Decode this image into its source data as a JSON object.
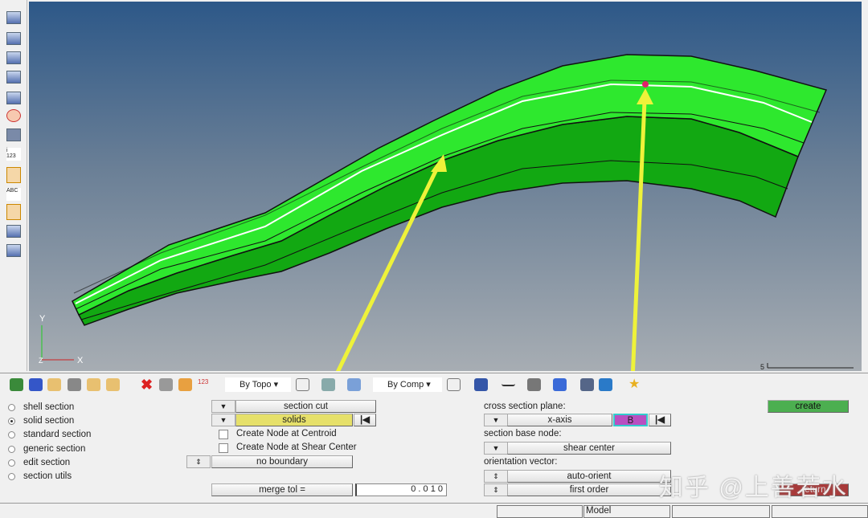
{
  "viewport": {
    "axis_x": "X",
    "axis_y": "Y",
    "axis_z": "Z",
    "scale_label": "5"
  },
  "toolbar": {
    "by_topo": "By Topo",
    "by_comp": "By Comp"
  },
  "panel": {
    "radios": [
      {
        "label": "shell section",
        "selected": false
      },
      {
        "label": "solid section",
        "selected": true
      },
      {
        "label": "standard section",
        "selected": false
      },
      {
        "label": "generic section",
        "selected": false
      },
      {
        "label": "edit section",
        "selected": false
      },
      {
        "label": "section utils",
        "selected": false
      }
    ],
    "section_cut": "section cut",
    "solids": "solids",
    "centroid_label": "Create Node at Centroid",
    "shear_center_label": "Create Node at Shear Center",
    "no_boundary": "no boundary",
    "merge_tol_label": "merge tol =",
    "merge_tol_value": "0 . 0 1 0",
    "cross_section_plane_label": "cross section plane:",
    "x_axis": "x-axis",
    "node_value": "B",
    "section_base_node_label": "section base node:",
    "shear_center": "shear center",
    "orientation_vector_label": "orientation vector:",
    "auto_orient": "auto-orient",
    "first_order": "first order",
    "create": "create",
    "return": "return"
  },
  "status": {
    "model": "Model"
  },
  "watermark": "知乎 @上善若水",
  "colors": {
    "create": "#4caf50",
    "return": "#a83a3a",
    "solids_highlight": "#e6e06a",
    "node_highlight": "#b94fc1",
    "part": "#22dd22"
  }
}
